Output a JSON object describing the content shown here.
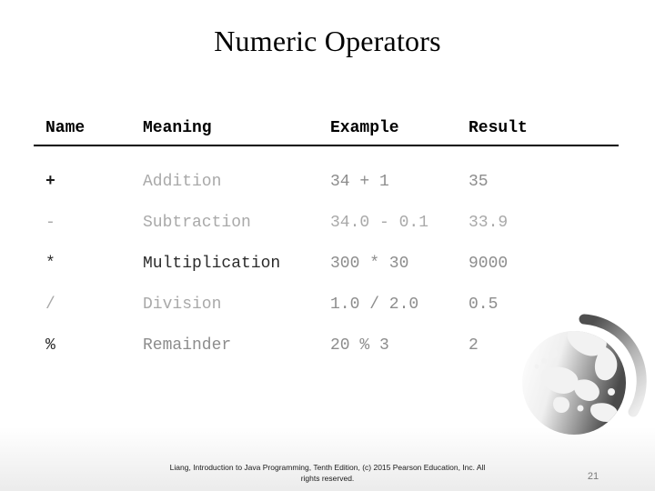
{
  "slide": {
    "title": "Numeric Operators",
    "page_number": "21",
    "footer_line1": "Liang, Introduction to Java Programming, Tenth Edition, (c) 2015 Pearson Education, Inc. All",
    "footer_line2": "rights reserved."
  },
  "table": {
    "headers": [
      "Name",
      "Meaning",
      "Example",
      "Result"
    ],
    "rows": [
      {
        "name": "+",
        "meaning": "Addition",
        "example": "34 + 1",
        "result": "35"
      },
      {
        "name": "-",
        "meaning": "Subtraction",
        "example": "34.0 - 0.1",
        "result": "33.9"
      },
      {
        "name": "*",
        "meaning": "Multiplication",
        "example": "300 * 30",
        "result": "9000"
      },
      {
        "name": "/",
        "meaning": "Division",
        "example": "1.0 / 2.0",
        "result": "0.5"
      },
      {
        "name": "%",
        "meaning": "Remainder",
        "example": "20 % 3",
        "result": "2"
      }
    ]
  },
  "decoration": {
    "globe_icon": "globe-world-map",
    "globe_color_dark": "#595959",
    "globe_color_light": "#d9d9d9"
  },
  "colors": {
    "background": "#ffffff",
    "text": "#000000",
    "rule": "#000000",
    "muted_text": "#8d8d8d",
    "page_number_text": "#7a7a7a"
  }
}
